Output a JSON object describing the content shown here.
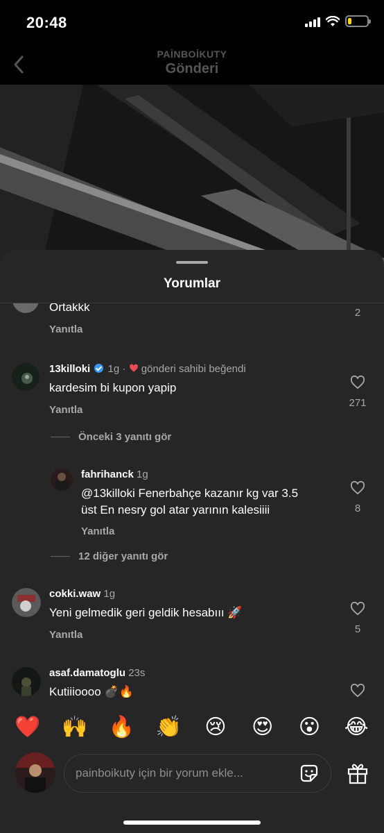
{
  "status_bar": {
    "time": "20:48",
    "battery_level": 0.2
  },
  "header": {
    "username": "PAİNBOİKUTY",
    "title": "Gönderi"
  },
  "sheet": {
    "title": "Yorumlar"
  },
  "comments": [
    {
      "text": "Ortakkk",
      "reply_label": "Yanıtla",
      "likes": "2"
    },
    {
      "username": "13killoki",
      "verified": true,
      "time": "1g",
      "liked_by_author": "gönderi sahibi beğendi",
      "text": "kardesim bi kupon yapip",
      "reply_label": "Yanıtla",
      "likes": "271"
    },
    {
      "username": "fahrihanck",
      "time": "1g",
      "text_line1": "@13killoki Fenerbahçe kazanır kg var 3.5",
      "text_line2": "üst En nesry gol atar yarının kalesiiii",
      "reply_label": "Yanıtla",
      "likes": "8"
    },
    {
      "username": "cokki.waw",
      "time": "1g",
      "text": "Yeni gelmedik geri geldik hesabııı 🚀",
      "reply_label": "Yanıtla",
      "likes": "5"
    },
    {
      "username": "asaf.damatoglu",
      "time": "23s",
      "text": "Kutiiioooo 💣🔥"
    }
  ],
  "view_previous_replies": "Önceki 3 yanıtı gör",
  "view_more_replies": "12 diğer yanıtı gör",
  "emoji_bar": [
    "❤️",
    "🙌",
    "🔥",
    "👏",
    "😢",
    "😍",
    "😮",
    "😂"
  ],
  "composer": {
    "placeholder": "painboikuty için bir yorum ekle..."
  },
  "colors": {
    "background": "#000000",
    "sheet": "#262626",
    "heart": "#ed4956",
    "verified": "#3897f0"
  },
  "icons": [
    "back-chevron-icon",
    "heart-icon",
    "sticker-icon",
    "gift-icon",
    "verified-icon"
  ]
}
